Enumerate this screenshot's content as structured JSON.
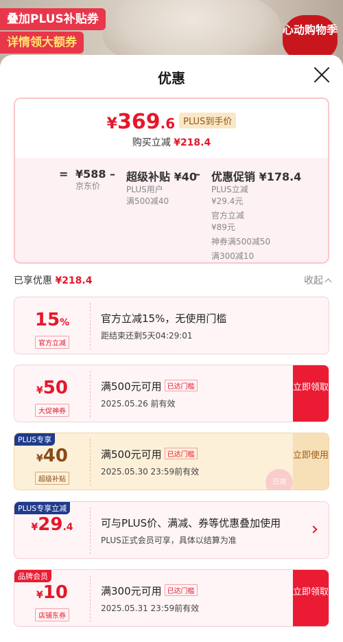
{
  "background": {
    "promo_tag_1": "叠加PLUS补贴券",
    "promo_tag_2": "详情领大额券",
    "badge": "心动购物季"
  },
  "sheet": {
    "title": "优惠"
  },
  "summary": {
    "price_yen": "¥",
    "price_int": "369",
    "price_dec": ".6",
    "plus_label": "PLUS到手价",
    "save_label": "购买立减",
    "save_value": "¥218.4",
    "breakdown": {
      "eq": "=",
      "jd_price": "¥588",
      "jd_price_label": "京东价",
      "minus1": "–",
      "subsidy": "超级补贴 ¥40",
      "subsidy_sub1": "PLUS用户",
      "subsidy_sub2": "满500减40",
      "minus2": "–",
      "promo": "优惠促销 ¥178.4",
      "promo_sub1": "PLUS立减",
      "promo_sub2": "¥29.4元",
      "promo_sub3": "官方立减",
      "promo_sub4": "¥89元",
      "promo_sub5": "神券满500减50",
      "promo_sub6": "满300减10"
    }
  },
  "enjoyed": {
    "label": "已享优惠",
    "value": "¥218.4",
    "collapse": "收起"
  },
  "coupons": [
    {
      "amount": "15",
      "amount_suffix": "%",
      "tag": "官方立减",
      "title": "官方立减15%，无使用门槛",
      "sub": "距结束还剩5天04:29:01"
    },
    {
      "yen": "¥",
      "amount": "50",
      "tag": "大促神券",
      "title": "满500元可用",
      "mini": "已达门槛",
      "sub": "2025.05.26 前有效",
      "button": "立即领取"
    },
    {
      "flag": "PLUS专享",
      "yen": "¥",
      "amount": "40",
      "tag": "超级补贴",
      "title": "满500元可用",
      "mini": "已达门槛",
      "sub": "2025.05.30 23:59前有效",
      "button": "立即使用",
      "stamp": "已领"
    },
    {
      "flag": "PLUS专享立减",
      "yen": "¥",
      "amount": "29",
      "amount_dec": ".4",
      "title": "可与PLUS价、满减、券等优惠叠加使用",
      "sub": "PLUS正式会员可享，具体以结算为准"
    },
    {
      "flag": "品牌会员",
      "yen": "¥",
      "amount": "10",
      "tag": "店铺东券",
      "title": "满300元可用",
      "mini": "已达门槛",
      "sub": "2025.05.31 23:59前有效",
      "button": "立即领取"
    }
  ],
  "colors": {
    "accent_red": "#e5172b",
    "plus_navy": "#1f3b8c",
    "gold_bg": "#fdf0d9"
  }
}
